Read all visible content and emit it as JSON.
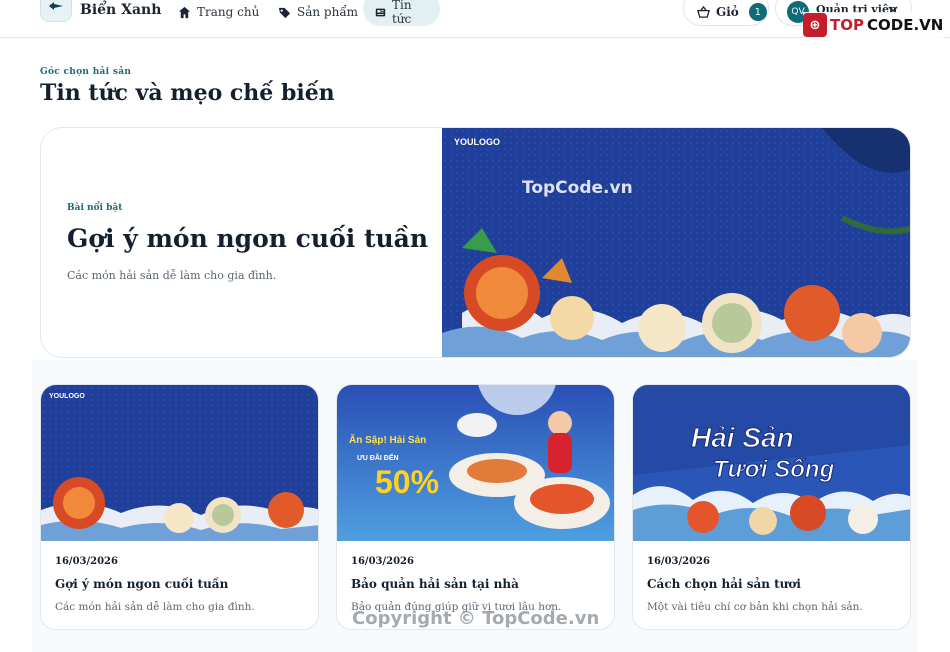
{
  "nav": {
    "brand": "Biển Xanh",
    "links": [
      {
        "label": "Trang chủ",
        "icon": "home-icon"
      },
      {
        "label": "Sản phẩm",
        "icon": "tag-icon"
      },
      {
        "label": "Tin tức",
        "icon": "newspaper-icon",
        "active": true
      }
    ],
    "cart_label": "Giỏ",
    "cart_count": "1",
    "user_initials": "QV",
    "user_name": "Quản trị viên"
  },
  "watermark": {
    "logo_text_a": "TOP",
    "logo_text_b": "CODE.VN",
    "center": "TopCode.vn",
    "bottom": "Copyright © TopCode.vn"
  },
  "header": {
    "eyebrow": "Góc chọn hải sản",
    "title": "Tin tức và mẹo chế biến"
  },
  "featured": {
    "eyebrow": "Bài nổi bật",
    "title": "Gợi ý món ngon cuối tuần",
    "description": "Các món hải sản dễ làm cho gia đình.",
    "image_texts": {
      "logo": "YOULOGO"
    }
  },
  "cards": [
    {
      "date": "16/03/2026",
      "title": "Gợi ý món ngon cuối tuần",
      "description": "Các món hải sản dễ làm cho gia đình.",
      "image_texts": {
        "logo": "YOULOGO"
      }
    },
    {
      "date": "16/03/2026",
      "title": "Bảo quản hải sản tại nhà",
      "description": "Bảo quản đúng giúp giữ vị tươi lâu hơn.",
      "image_texts": {
        "headline": "Ăn Sập! Hải Sản",
        "subline": "ƯU ĐÃI ĐẾN",
        "discount": "50%"
      }
    },
    {
      "date": "16/03/2026",
      "title": "Cách chọn hải sản tươi",
      "description": "Một vài tiêu chí cơ bản khi chọn hải sản.",
      "image_texts": {
        "line1": "Hải Sản",
        "line2": "Tươi Sống"
      }
    }
  ],
  "colors": {
    "accent": "#0f6b77",
    "navy_image": "#1f3f9a"
  }
}
